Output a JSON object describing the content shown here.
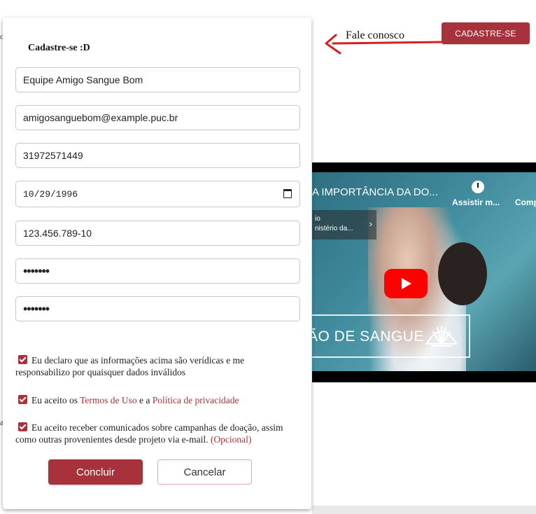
{
  "header": {
    "contact_link": "Fale conosco",
    "signup_button": "CADASTRE-SE"
  },
  "background": {
    "fragments": [
      "o",
      "a"
    ]
  },
  "video": {
    "title": "A IMPORTÂNCIA DA DO...",
    "watch_later": "Assistir m...",
    "share": "Comp",
    "channel_line1": "io",
    "channel_line2": "nistério da...",
    "banner_text": "ÃO DE SANGUE"
  },
  "form": {
    "title": "Cadastre-se :D",
    "name_value": "Equipe Amigo Sangue Bom",
    "email_value": "amigosanguebom@example.puc.br",
    "phone_value": "31972571449",
    "birthdate_value": "10/29/1996",
    "cpf_value": "123.456.789-10",
    "password_value": "•••••••",
    "password_confirm_value": "•••••••",
    "check_declare": "Eu declaro que as informações acima são verídicas e me responsabilizo por quaisquer dados inválidos",
    "check_terms_prefix": "Eu aceito os ",
    "terms_link": "Termos de Uso",
    "check_terms_middle": " e a ",
    "privacy_link": "Política de privacidade",
    "check_newsletter": "Eu aceito receber comunicados sobre campanhas de doação, assim como outras provenientes desde projeto via e-mail.",
    "optional_label": "(Opcional)",
    "submit_button": "Concluir",
    "cancel_button": "Cancelar"
  },
  "colors": {
    "brand": "#a8323c",
    "annotation_arrow": "#d32020"
  }
}
